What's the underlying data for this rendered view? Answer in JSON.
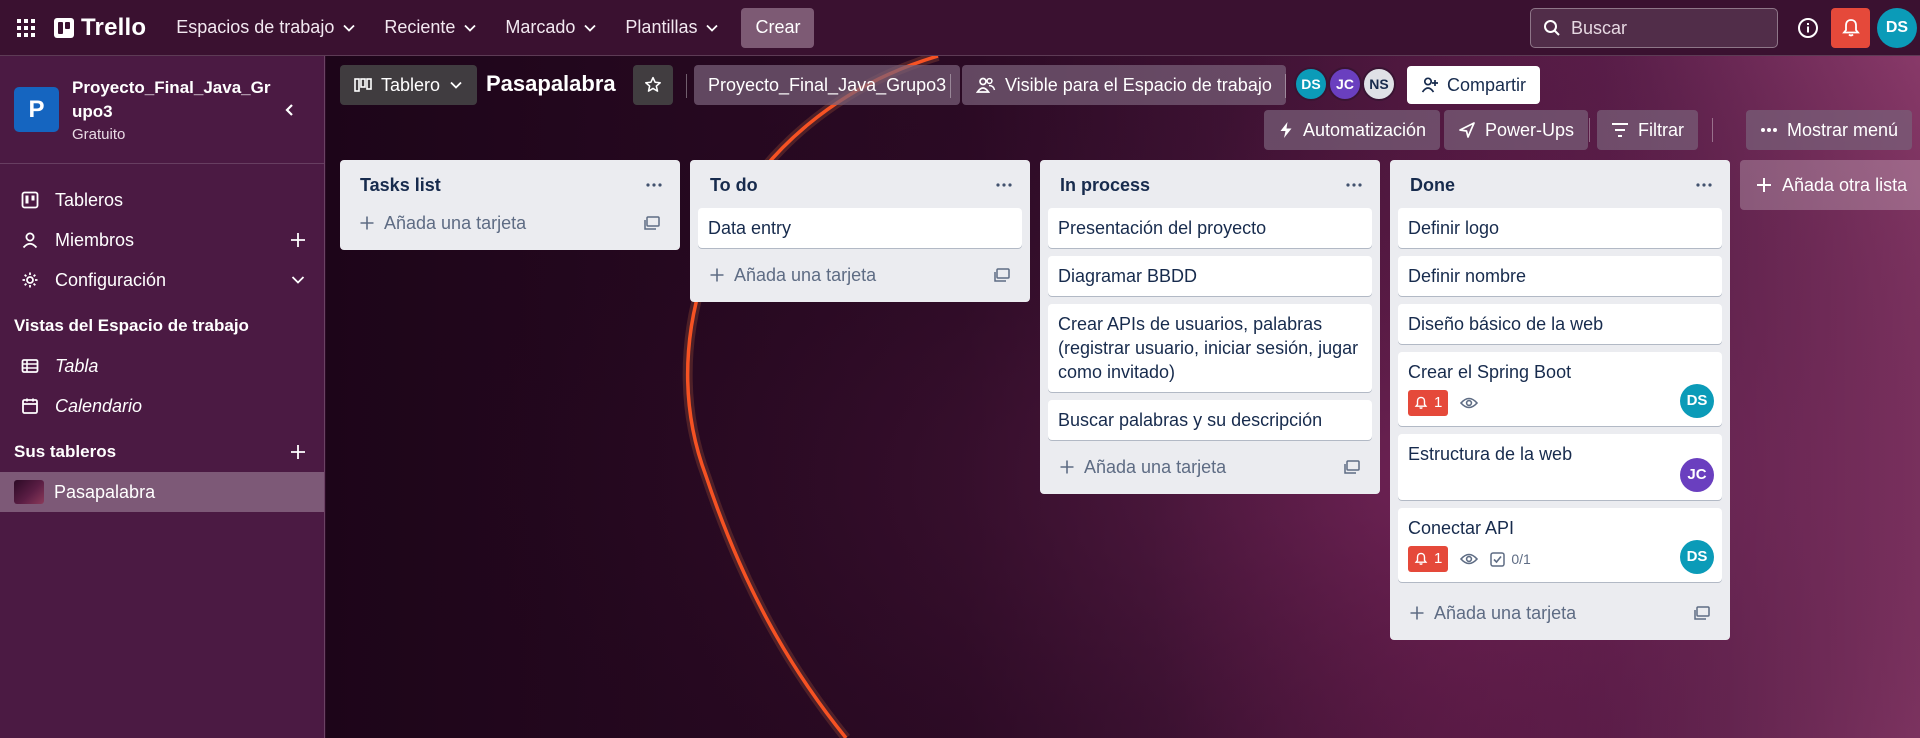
{
  "topbar": {
    "logo_text": "Trello",
    "nav": [
      {
        "label": "Espacios de trabajo"
      },
      {
        "label": "Reciente"
      },
      {
        "label": "Marcado"
      },
      {
        "label": "Plantillas"
      }
    ],
    "create_label": "Crear",
    "search_placeholder": "Buscar",
    "user_initials": "DS"
  },
  "sidebar": {
    "workspace_initial": "P",
    "workspace_name": "Proyecto_Final_Java_Grupo3",
    "workspace_plan": "Gratuito",
    "items": [
      {
        "label": "Tableros",
        "icon": "trello-board-icon"
      },
      {
        "label": "Miembros",
        "icon": "person-icon"
      },
      {
        "label": "Configuración",
        "icon": "gear-icon"
      }
    ],
    "views_title": "Vistas del Espacio de trabajo",
    "views": [
      {
        "label": "Tabla",
        "icon": "table-icon"
      },
      {
        "label": "Calendario",
        "icon": "calendar-icon"
      }
    ],
    "boards_title": "Sus tableros",
    "boards": [
      {
        "label": "Pasapalabra"
      }
    ]
  },
  "board_header": {
    "view_label": "Tablero",
    "title": "Pasapalabra",
    "workspace_label": "Proyecto_Final_Java_Grupo3",
    "visibility_label": "Visible para el Espacio de trabajo",
    "members": [
      {
        "initials": "DS",
        "color": "#0b9bb8"
      },
      {
        "initials": "JC",
        "color": "#6a3fbf"
      },
      {
        "initials": "NS",
        "color": "#dfe1e6"
      }
    ],
    "share_label": "Compartir",
    "automation_label": "Automatización",
    "powerups_label": "Power-Ups",
    "filter_label": "Filtrar",
    "menu_label": "Mostrar menú"
  },
  "lists": [
    {
      "title": "Tasks list",
      "cards": [],
      "add_label": "Añada una tarjeta"
    },
    {
      "title": "To do",
      "cards": [
        {
          "title": "Data entry"
        }
      ],
      "add_label": "Añada una tarjeta"
    },
    {
      "title": "In process",
      "cards": [
        {
          "title": "Presentación del proyecto"
        },
        {
          "title": "Diagramar BBDD"
        },
        {
          "title": "Crear APIs de usuarios, palabras (registrar usuario, iniciar sesión, jugar como invitado)"
        },
        {
          "title": "Buscar palabras y su descripción"
        }
      ],
      "add_label": "Añada una tarjeta"
    },
    {
      "title": "Done",
      "cards": [
        {
          "title": "Definir logo"
        },
        {
          "title": "Definir nombre"
        },
        {
          "title": "Diseño básico de la web"
        },
        {
          "title": "Crear el Spring Boot",
          "notif": "1",
          "member": "DS"
        },
        {
          "title": "Estructura de la web",
          "member": "JC"
        },
        {
          "title": "Conectar API",
          "notif": "1",
          "checklist": "0/1",
          "member": "DS"
        }
      ],
      "add_label": "Añada una tarjeta"
    }
  ],
  "add_list_label": "Añada otra lista",
  "colors": {
    "accent_red": "#e5493a",
    "teal": "#0b9bb8",
    "purple": "#6a3fbf"
  }
}
